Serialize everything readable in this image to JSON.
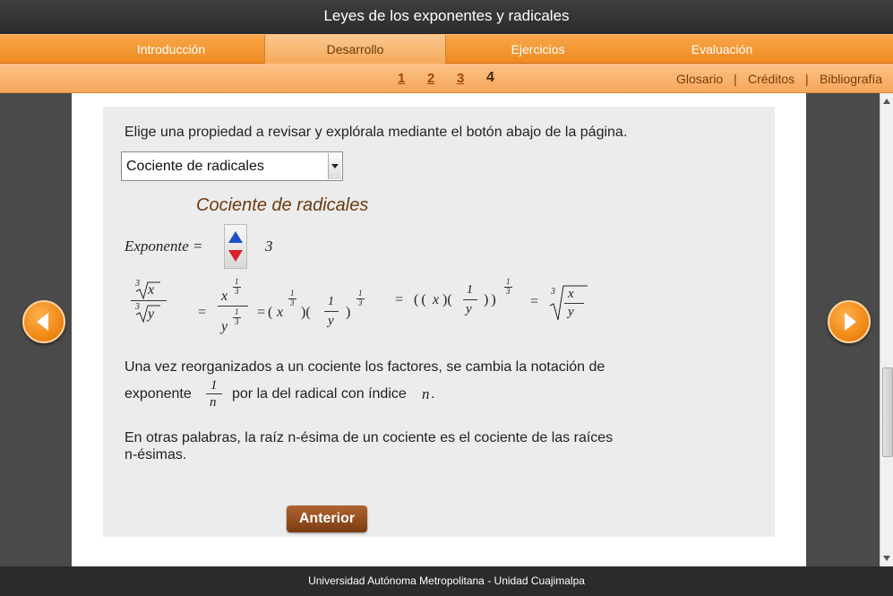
{
  "window": {
    "title": "Leyes de los exponentes y radicales"
  },
  "nav": {
    "tabs": [
      "Introducción",
      "Desarrollo",
      "Ejercicios",
      "Evaluación"
    ],
    "active": "Desarrollo"
  },
  "pager": {
    "pages": [
      "1",
      "2",
      "3",
      "4"
    ],
    "current": "4"
  },
  "links": {
    "glosario": "Glosario",
    "creditos": "Créditos",
    "bibliografia": "Bibliografía",
    "separator": "|"
  },
  "content": {
    "instruction": "Elige una propiedad a revisar y explórala mediante el botón abajo de la página.",
    "select_value": "Cociente de radicales",
    "heading": "Cociente de radicales",
    "exponent_label": "Exponente =",
    "exponent_value": "3",
    "math": {
      "x": "x",
      "y": "y",
      "one": "1",
      "three": "3",
      "eq": "=",
      "n": "n"
    },
    "para1_line1": "Una vez reorganizados a un cociente los factores, se cambia la notación de",
    "para1_pre": "exponente",
    "para1_post": "por la del radical con índice",
    "para1_end": ".",
    "para2_line1": "En otras palabras, la raíz n-ésima de un cociente es el cociente de las raíces",
    "para2_line2": "n-ésimas.",
    "prev_button": "Anterior"
  },
  "footer": {
    "text": "Universidad Autónoma Metropolitana - Unidad Cuajimalpa"
  },
  "colors": {
    "accent": "#ef8a22",
    "heading": "#6b3a10",
    "button": "#7a3c12"
  }
}
